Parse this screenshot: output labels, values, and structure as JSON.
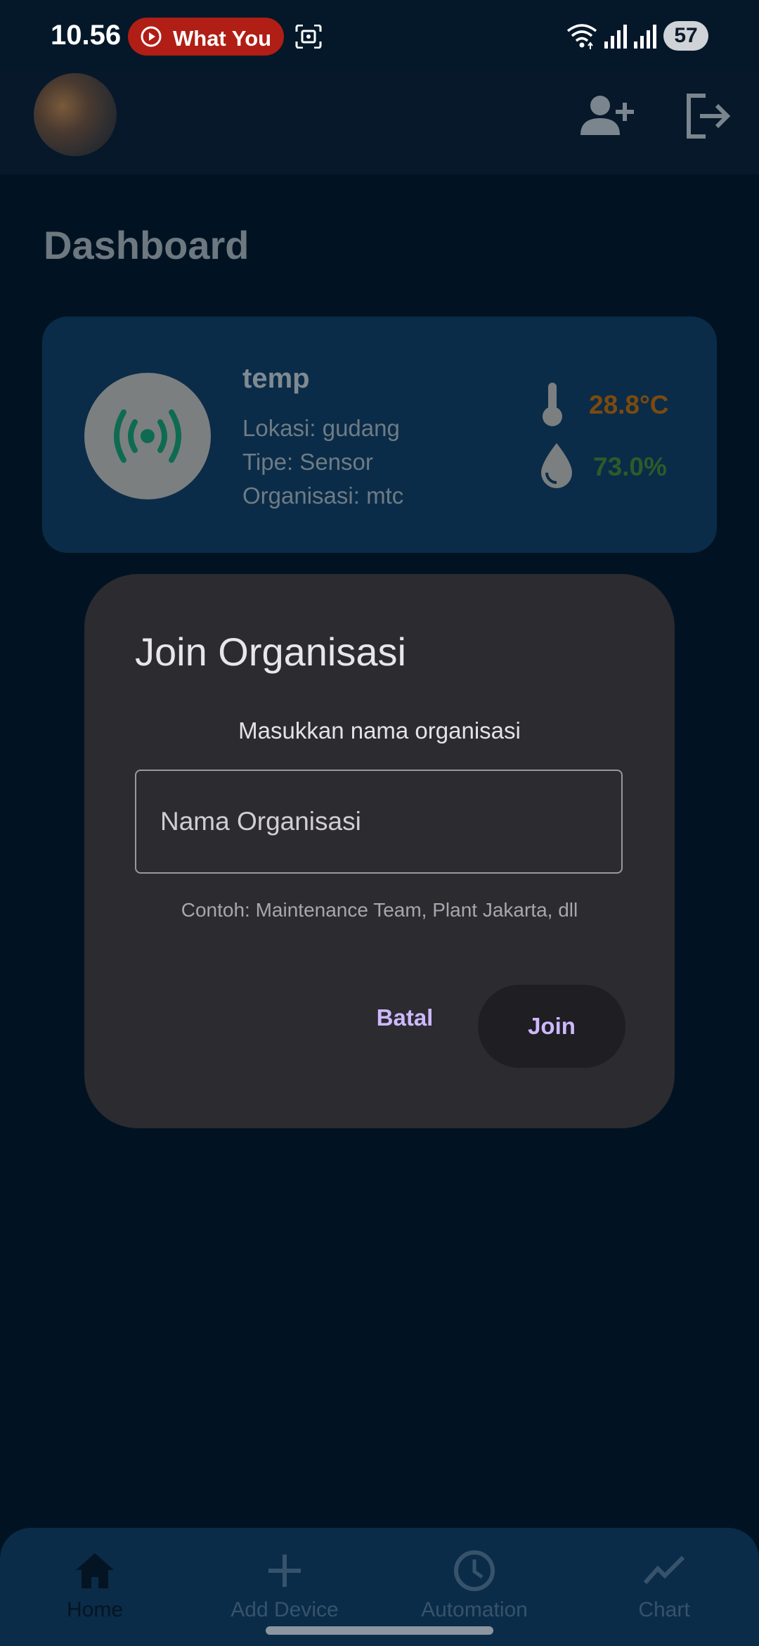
{
  "status_bar": {
    "time": "10.56",
    "media_label": "What You",
    "battery": "57"
  },
  "app_bar": {
    "avatar": "profile-photo",
    "actions": [
      "add-user-icon",
      "logout-icon"
    ]
  },
  "page": {
    "title": "Dashboard"
  },
  "device_card": {
    "name": "temp",
    "location": "Lokasi: gudang",
    "type": "Tipe: Sensor",
    "organization": "Organisasi: mtc",
    "temperature": "28.8°C",
    "humidity": "73.0%",
    "icon": "sensor-broadcast-icon",
    "colors": {
      "temperature": "#7c4a0e",
      "humidity": "#2f5a2a",
      "sensor_icon": "#0e6b52"
    }
  },
  "dialog": {
    "title": "Join Organisasi",
    "subtitle": "Masukkan nama organisasi",
    "input_placeholder": "Nama Organisasi",
    "input_value": "",
    "hint": "Contoh: Maintenance Team, Plant Jakarta, dll",
    "cancel_label": "Batal",
    "join_label": "Join",
    "accent_color": "#cdb8ff"
  },
  "bottom_nav": {
    "items": [
      {
        "label": "Home",
        "icon": "home-icon",
        "active": true
      },
      {
        "label": "Add Device",
        "icon": "plus-icon",
        "active": false
      },
      {
        "label": "Automation",
        "icon": "clock-icon",
        "active": false
      },
      {
        "label": "Chart",
        "icon": "chart-line-icon",
        "active": false
      }
    ]
  }
}
